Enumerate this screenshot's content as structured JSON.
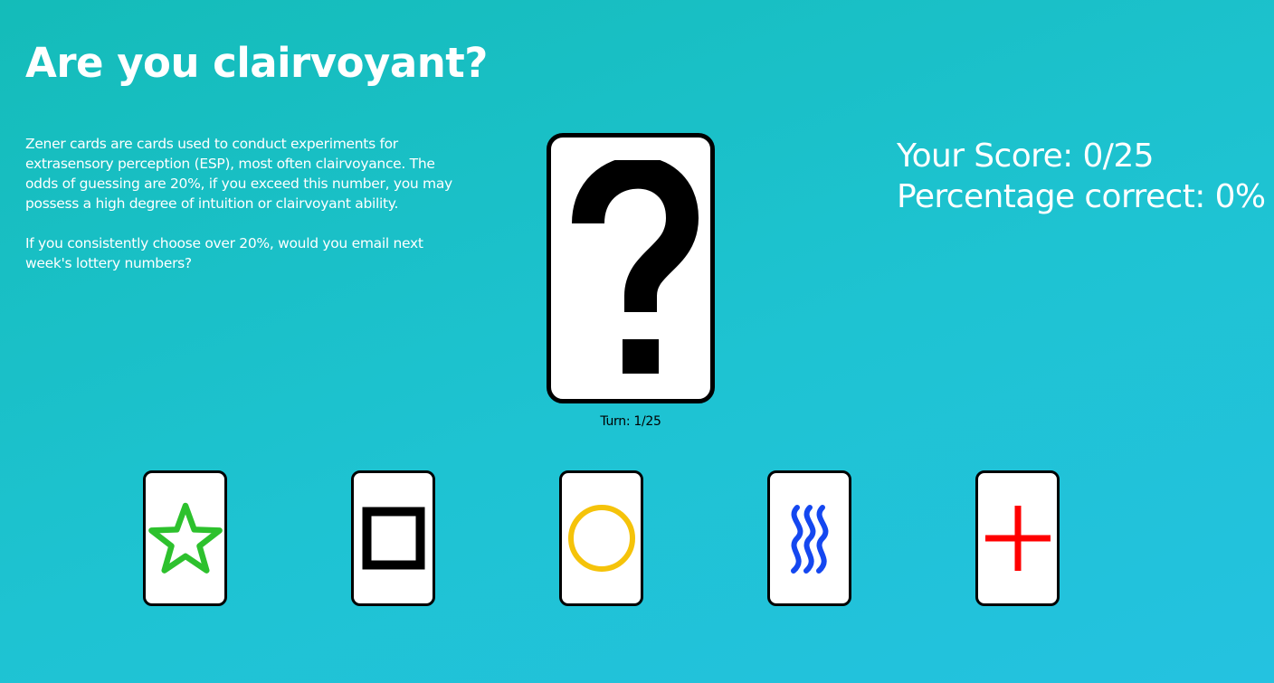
{
  "page": {
    "title": "Are you clairvoyant?",
    "intro_paragraph_1": "Zener cards are cards used to conduct experiments for extrasensory perception (ESP), most often clairvoyance. The odds of guessing are 20%, if you exceed this number, you may possess a high degree of intuition or clairvoyant ability.",
    "intro_paragraph_2": "If you consistently choose over 20%, would you email next week's lottery numbers?"
  },
  "game": {
    "mystery_card_icon": "question-mark-icon",
    "turn_label": "Turn: 1/25",
    "score_label": "Your Score: 0/25",
    "percentage_label": "Percentage correct: 0%"
  },
  "choices": [
    {
      "name": "star",
      "icon": "star-icon",
      "color": "#2dc12d"
    },
    {
      "name": "square",
      "icon": "square-icon",
      "color": "#000000"
    },
    {
      "name": "circle",
      "icon": "circle-icon",
      "color": "#f5c30a"
    },
    {
      "name": "waves",
      "icon": "waves-icon",
      "color": "#1447f0"
    },
    {
      "name": "cross",
      "icon": "cross-icon",
      "color": "#ff0000"
    }
  ],
  "colors": {
    "background_start": "#14bcb9",
    "background_end": "#24c2e0",
    "text": "#ffffff",
    "card_background": "#ffffff",
    "card_border": "#000000"
  }
}
